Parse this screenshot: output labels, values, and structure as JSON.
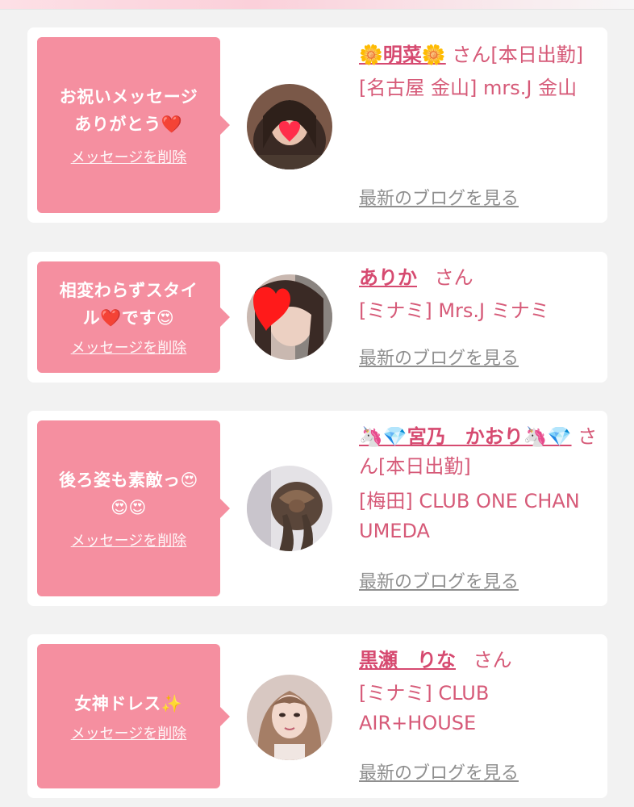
{
  "messages": [
    {
      "bubble_text": "お祝いメッセージ\nありがとう❤️",
      "delete_label": "メッセージを削除",
      "name": "🌼明菜🌼",
      "honorific": "さん[本日出勤]",
      "shop": "[名古屋 金山] mrs.J 金山",
      "blog_label": "最新のブログを見る"
    },
    {
      "bubble_text": "相変わらずスタイ\nル❤️です😍",
      "delete_label": "メッセージを削除",
      "name": "ありか",
      "honorific": "さん",
      "shop": "[ミナミ] Mrs.J ミナミ",
      "blog_label": "最新のブログを見る"
    },
    {
      "bubble_text": "後ろ姿も素敵っ😍\n😍😍",
      "delete_label": "メッセージを削除",
      "name": "🦄💎宮乃　かおり🦄💎",
      "honorific": "さん[本日出勤]",
      "shop": "[梅田] CLUB ONE CHAN UMEDA",
      "blog_label": "最新のブログを見る"
    },
    {
      "bubble_text": "女神ドレス✨",
      "delete_label": "メッセージを削除",
      "name": "黒瀬　りな",
      "honorific": "さん",
      "shop": "[ミナミ] CLUB AIR+HOUSE",
      "blog_label": "最新のブログを見る"
    }
  ],
  "colors": {
    "bubble": "#f58fa0",
    "name": "#d64a70",
    "text": "#d65a78",
    "link_gray": "#8f8f8f",
    "background": "#f2f2f2"
  }
}
